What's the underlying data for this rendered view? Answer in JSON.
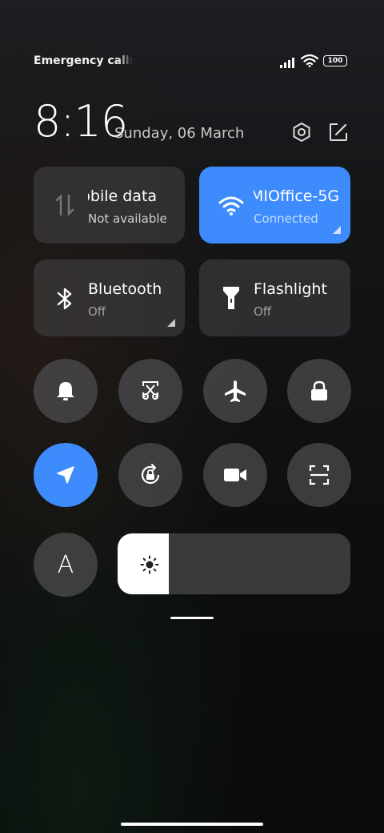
{
  "status_bar": {
    "carrier_text": "Emergency calls o",
    "battery": "100"
  },
  "header": {
    "time": "8:16",
    "date": "Sunday, 06 March"
  },
  "tiles": [
    {
      "title": "lobile data",
      "subtitle": "Not available",
      "icon": "mobile-data-icon",
      "active": false
    },
    {
      "title": "MIOffice-5G",
      "subtitle": "Connected",
      "icon": "wifi-icon",
      "active": true
    },
    {
      "title": "Bluetooth",
      "subtitle": "Off",
      "icon": "bluetooth-icon",
      "active": false
    },
    {
      "title": "Flashlight",
      "subtitle": "Off",
      "icon": "flashlight-icon",
      "active": false
    }
  ],
  "toggles_row1": [
    "bell-icon",
    "screenshot-icon",
    "airplane-icon",
    "lock-icon"
  ],
  "toggles_row2": [
    "location-icon",
    "rotation-lock-icon",
    "video-icon",
    "scan-icon"
  ],
  "brightness": {
    "level": 0.22,
    "auto_label": "A"
  },
  "colors": {
    "accent": "#3d8bfd",
    "tile_bg": "#3a3a3c"
  }
}
